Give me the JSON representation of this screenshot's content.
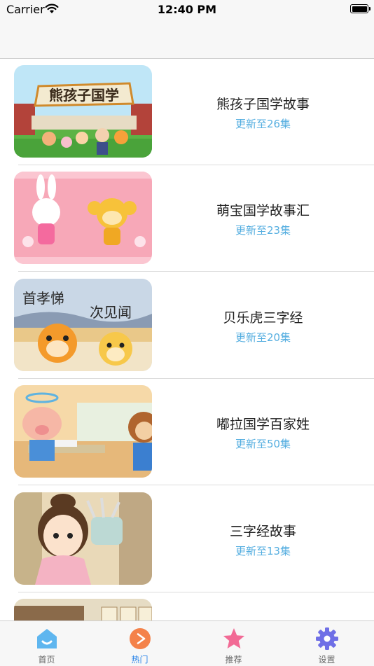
{
  "status_bar": {
    "carrier": "Carrier",
    "time": "12:40 PM"
  },
  "list": [
    {
      "title": "熊孩子国学故事",
      "subtitle": "更新至26集",
      "thumb_text": "熊孩子国学"
    },
    {
      "title": "萌宝国学故事汇",
      "subtitle": "更新至23集"
    },
    {
      "title": "贝乐虎三字经",
      "subtitle": "更新至20集",
      "thumb_text_1": "首孝悌",
      "thumb_text_2": "次见闻"
    },
    {
      "title": "嘟拉国学百家姓",
      "subtitle": "更新至50集"
    },
    {
      "title": "三字经故事",
      "subtitle": "更新至13集"
    }
  ],
  "tabs": [
    {
      "label": "首页",
      "icon": "home-icon"
    },
    {
      "label": "热门",
      "icon": "play-icon",
      "active": true
    },
    {
      "label": "推荐",
      "icon": "star-icon"
    },
    {
      "label": "设置",
      "icon": "gear-icon"
    }
  ],
  "colors": {
    "accent": "#2a84e8",
    "subtitle": "#55aee0",
    "bar_bg": "#f7f7f7"
  }
}
